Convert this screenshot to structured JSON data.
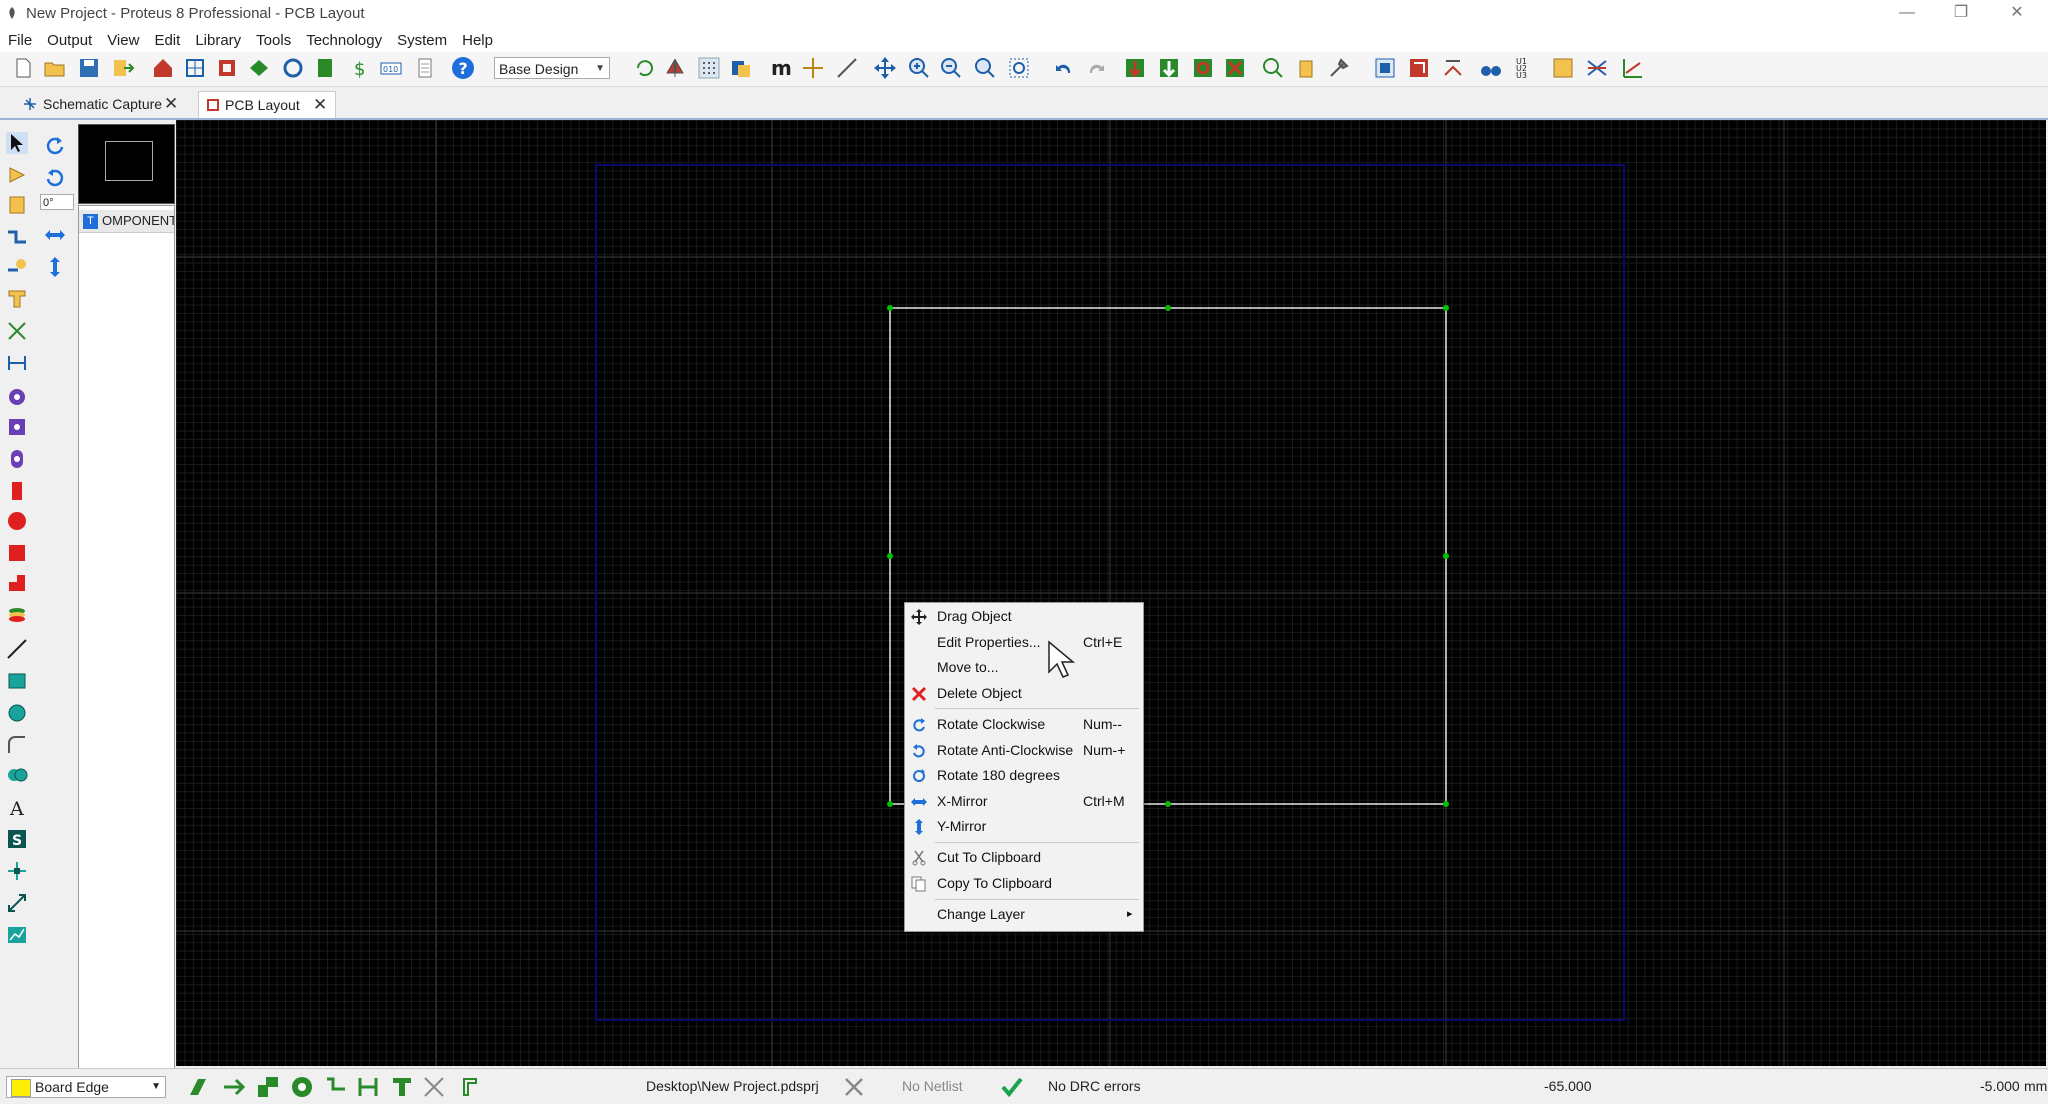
{
  "window": {
    "title": "New Project - Proteus 8 Professional - PCB Layout",
    "controls": [
      "—",
      "❐",
      "✕"
    ]
  },
  "menubar": [
    "File",
    "Output",
    "View",
    "Edit",
    "Library",
    "Tools",
    "Technology",
    "System",
    "Help"
  ],
  "toolbar": {
    "design_select": "Base Design"
  },
  "tabs": [
    {
      "label": "Schematic Capture",
      "active": false
    },
    {
      "label": "PCB Layout",
      "active": true
    }
  ],
  "selector": {
    "angle": "0°",
    "header_badge": "T",
    "header_label": "OMPONENT"
  },
  "context_menu": {
    "items": [
      {
        "label": "Drag Object",
        "shortcut": "",
        "icon": "drag-icon"
      },
      {
        "label": "Edit Properties...",
        "shortcut": "Ctrl+E",
        "icon": ""
      },
      {
        "label": "Move to...",
        "shortcut": "",
        "icon": ""
      },
      {
        "label": "Delete Object",
        "shortcut": "",
        "icon": "delete-icon"
      },
      {
        "label": "Rotate Clockwise",
        "shortcut": "Num--",
        "icon": "rotate-cw-icon"
      },
      {
        "label": "Rotate Anti-Clockwise",
        "shortcut": "Num-+",
        "icon": "rotate-ccw-icon"
      },
      {
        "label": "Rotate 180 degrees",
        "shortcut": "",
        "icon": "rotate-180-icon"
      },
      {
        "label": "X-Mirror",
        "shortcut": "Ctrl+M",
        "icon": "x-mirror-icon"
      },
      {
        "label": "Y-Mirror",
        "shortcut": "",
        "icon": "y-mirror-icon"
      },
      {
        "label": "Cut To Clipboard",
        "shortcut": "",
        "icon": "cut-icon"
      },
      {
        "label": "Copy To Clipboard",
        "shortcut": "",
        "icon": "copy-icon"
      },
      {
        "label": "Change Layer",
        "shortcut": "▸",
        "icon": ""
      }
    ]
  },
  "statusbar": {
    "layer": "Board Edge",
    "project_path": "Desktop\\New Project.pdsprj",
    "netlist_status": "No Netlist",
    "drc_status": "No DRC errors",
    "coord_x": "-65.000",
    "coord_y": "-5.000",
    "units": "mm"
  },
  "colors": {
    "board_outline": "#e6e6e6",
    "handle": "#00c000",
    "board_boundary": "#0a0a6a",
    "major_grid": "#3a3a3a",
    "layer_swatch": "#ffef00"
  }
}
